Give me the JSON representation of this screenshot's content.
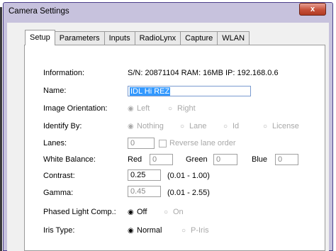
{
  "window": {
    "title": "Camera Settings",
    "close_label": "x"
  },
  "tabs": [
    "Setup",
    "Parameters",
    "Inputs",
    "RadioLynx",
    "Capture",
    "WLAN"
  ],
  "form": {
    "information": {
      "label": "Information:",
      "value": "S/N: 20871104   RAM: 16MB   IP: 192.168.0.6"
    },
    "name": {
      "label": "Name:",
      "value": "IDL Hi REZ"
    },
    "image_orientation": {
      "label": "Image Orientation:",
      "left": "Left",
      "right": "Right"
    },
    "identify_by": {
      "label": "Identify By:",
      "nothing": "Nothing",
      "lane": "Lane",
      "id": "Id",
      "license": "License"
    },
    "lanes": {
      "label": "Lanes:",
      "value": "0",
      "reverse_label": "Reverse lane order"
    },
    "white_balance": {
      "label": "White Balance:",
      "red_label": "Red",
      "red_value": "0",
      "green_label": "Green",
      "green_value": "0",
      "blue_label": "Blue",
      "blue_value": "0"
    },
    "contrast": {
      "label": "Contrast:",
      "value": "0.25",
      "range": "(0.01 - 1.00)"
    },
    "gamma": {
      "label": "Gamma:",
      "value": "0.45",
      "range": "(0.01 - 2.55)"
    },
    "phased_light": {
      "label": "Phased Light Comp.:",
      "off": "Off",
      "on": "On"
    },
    "iris_type": {
      "label": "Iris Type:",
      "normal": "Normal",
      "piris": "P-Iris"
    }
  }
}
